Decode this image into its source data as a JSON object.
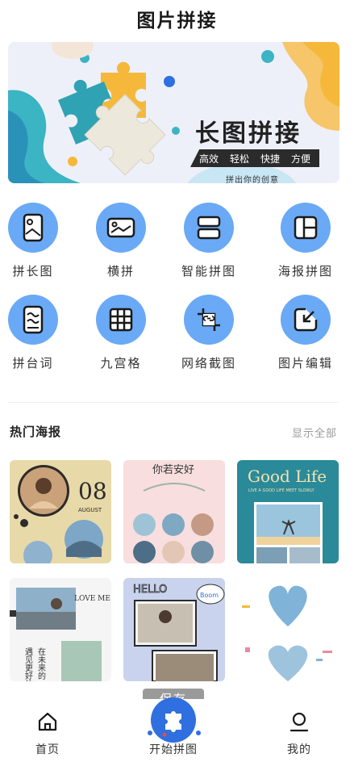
{
  "header": {
    "title": "图片拼接"
  },
  "banner": {
    "title": "长图拼接",
    "tags": [
      "高效",
      "轻松",
      "快捷",
      "方便"
    ],
    "subtitle": "拼出你的创意"
  },
  "tools": [
    {
      "label": "拼长图",
      "icon": "long-image-icon"
    },
    {
      "label": "横拼",
      "icon": "horizontal-stitch-icon"
    },
    {
      "label": "智能拼图",
      "icon": "smart-collage-icon"
    },
    {
      "label": "海报拼图",
      "icon": "poster-collage-icon"
    },
    {
      "label": "拼台词",
      "icon": "subtitle-stitch-icon"
    },
    {
      "label": "九宫格",
      "icon": "nine-grid-icon"
    },
    {
      "label": "网络截图",
      "icon": "web-screenshot-icon"
    },
    {
      "label": "图片编辑",
      "icon": "image-edit-icon"
    }
  ],
  "hot_posters": {
    "title": "热门海报",
    "more_label": "显示全部",
    "items": [
      {
        "texts": [
          "08",
          "AUGUST"
        ]
      },
      {
        "texts": [
          "你若安好"
        ]
      },
      {
        "texts": [
          "Good Life",
          "LIVE A GOOD LIFE MEET SLOWLY"
        ]
      },
      {
        "texts": [
          "LOVE ME",
          "在未来的",
          "遇见更好的"
        ]
      },
      {
        "texts": [
          "HELLO",
          "Boom"
        ]
      },
      {
        "texts": []
      }
    ]
  },
  "save_tooltip": "保存",
  "bottom_nav": {
    "home": "首页",
    "start": "开始拼图",
    "mine": "我的"
  },
  "colors": {
    "accent": "#6aa9f5",
    "fab": "#2f6fe0",
    "banner_orange": "#f5b83a",
    "banner_teal": "#3bb4c4"
  }
}
